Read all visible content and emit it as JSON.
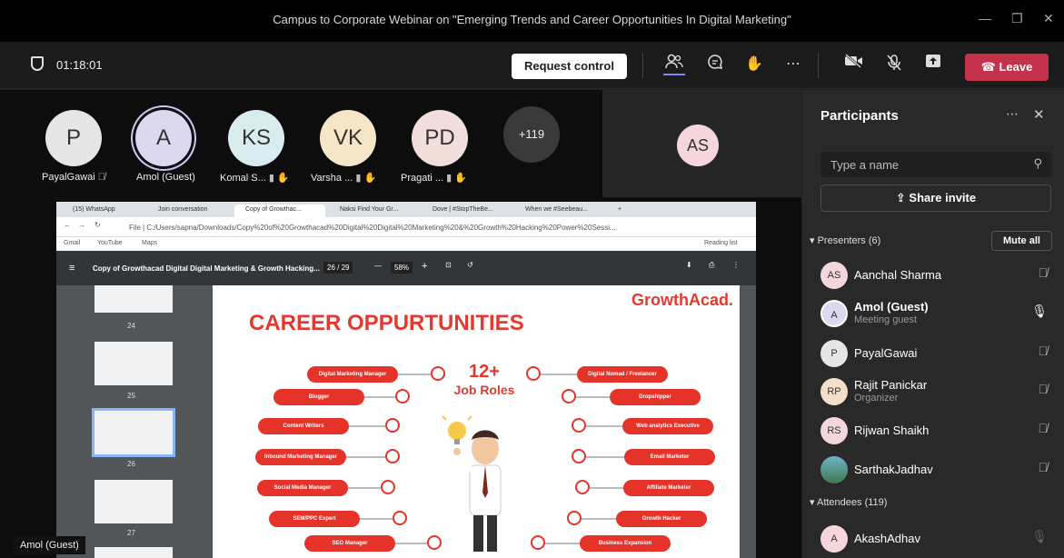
{
  "window": {
    "title": "Campus to Corporate Webinar on \"Emerging Trends and Career Opportunities In Digital Marketing\""
  },
  "toolbar": {
    "timer": "01:18:01",
    "request_control": "Request control",
    "leave": "Leave"
  },
  "video": {
    "participants": [
      {
        "initials": "P",
        "name": "PayalGawai",
        "color": "#e6e6e6"
      },
      {
        "initials": "A",
        "name": "Amol (Guest)",
        "color": "#dcd8f0"
      },
      {
        "initials": "KS",
        "name": "Komal S...",
        "color": "#d9ecef"
      },
      {
        "initials": "VK",
        "name": "Varsha ...",
        "color": "#f6e6c8"
      },
      {
        "initials": "PD",
        "name": "Pragati ...",
        "color": "#f2dfdc"
      }
    ],
    "overflow": "+119",
    "spotlight": "AS",
    "self_name": "Amol (Guest)"
  },
  "browser": {
    "tabs": [
      "(15) WhatsApp",
      "Join conversation",
      "Copy of Growthac...",
      "Naksi Find Your Gr...",
      "Dove | #StopTheBe...",
      "When we #Seebeau..."
    ],
    "url": "File | C:/Users/sapna/Downloads/Copy%20of%20Growthacad%20Digital%20Digital%20Marketing%20&%20Growth%20Hacking%20Power%20Sessi...",
    "bookmarks": [
      "Gmail",
      "YouTube",
      "Maps"
    ],
    "reading_list": "Reading list"
  },
  "pdf": {
    "doc_title": "Copy of Growthacad Digital Digital Marketing & Growth Hacking...",
    "page": "26 / 29",
    "zoom": "58%",
    "thumb_numbers": [
      "24",
      "25",
      "26",
      "27"
    ]
  },
  "slide": {
    "brand": "GrowthAcad.",
    "heading": "CAREER OPPURTUNITIES",
    "big_number": "12+",
    "big_label": "Job Roles",
    "left_roles": [
      "Digital Marketing Manager",
      "Blogger",
      "Content Writers",
      "Inbound Marketing Manager",
      "Social Media Manager",
      "SEM/PPC Expert",
      "SEO Manager"
    ],
    "right_roles": [
      "Digital Nomad / Freelancer",
      "Dropshipper",
      "Web analytics Executive",
      "Email Marketer",
      "Affiliate Marketer",
      "Growth Hacker",
      "Business Expansion"
    ]
  },
  "panel": {
    "title": "Participants",
    "search_placeholder": "Type a name",
    "share_invite": "Share invite",
    "presenters_label": "Presenters (6)",
    "mute_all": "Mute all",
    "presenters": [
      {
        "initials": "AS",
        "name": "Aanchal Sharma",
        "role": ""
      },
      {
        "initials": "A",
        "name": "Amol (Guest)",
        "role": "Meeting guest"
      },
      {
        "initials": "P",
        "name": "PayalGawai",
        "role": ""
      },
      {
        "initials": "RP",
        "name": "Rajit Panickar",
        "role": "Organizer"
      },
      {
        "initials": "RS",
        "name": "Rijwan Shaikh",
        "role": ""
      },
      {
        "initials": "",
        "name": "SarthakJadhav",
        "role": ""
      }
    ],
    "attendees_label": "Attendees (119)",
    "attendees": [
      {
        "initials": "A",
        "name": "AkashAdhav"
      }
    ]
  }
}
